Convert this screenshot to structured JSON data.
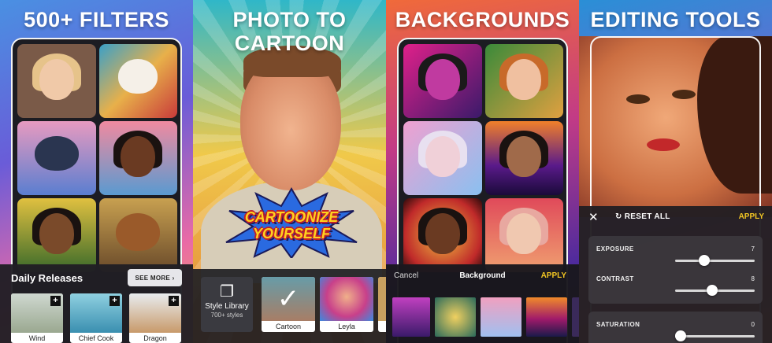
{
  "panels": {
    "filters": {
      "headline": "500+ FILTERS",
      "section_title": "Daily Releases",
      "see_more": "SEE MORE ›",
      "releases": [
        {
          "label": "Wind"
        },
        {
          "label": "Chief Cook"
        },
        {
          "label": "Dragon"
        }
      ]
    },
    "cartoon": {
      "headline_line1": "PHOTO TO",
      "headline_line2": "CARTOON",
      "sticker_line1": "CARTOONIZE",
      "sticker_line2": "YOURSELF",
      "library_label": "Style Library",
      "library_sub": "700+ styles",
      "styles": [
        {
          "label": "Cartoon"
        },
        {
          "label": "Leyla"
        }
      ]
    },
    "backgrounds": {
      "headline": "BACKGROUNDS",
      "cancel": "Cancel",
      "title": "Background",
      "apply": "APPLY"
    },
    "editing": {
      "headline": "EDITING TOOLS",
      "reset": "RESET ALL",
      "apply": "APPLY",
      "sliders": [
        {
          "label": "EXPOSURE",
          "value": "7"
        },
        {
          "label": "CONTRAST",
          "value": "8"
        },
        {
          "label": "SATURATION",
          "value": "0"
        }
      ]
    }
  },
  "colors": {
    "accent_yellow": "#f3c623",
    "sheet_bg": "#201e24"
  }
}
